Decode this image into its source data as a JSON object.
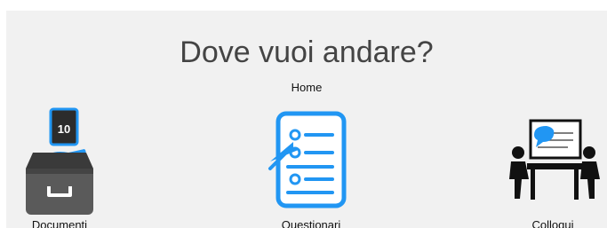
{
  "page": {
    "title": "Dove vuoi andare?",
    "subtitle": "Home"
  },
  "cards": [
    {
      "label": "Documenti",
      "icon": "document-archive-icon"
    },
    {
      "label": "Questionari",
      "icon": "questionnaire-icon"
    },
    {
      "label": "Colloqui",
      "icon": "meeting-icon"
    }
  ],
  "colors": {
    "panel_background": "#f1f1f1",
    "accent_blue": "#2196f3",
    "title_text": "#444444"
  }
}
